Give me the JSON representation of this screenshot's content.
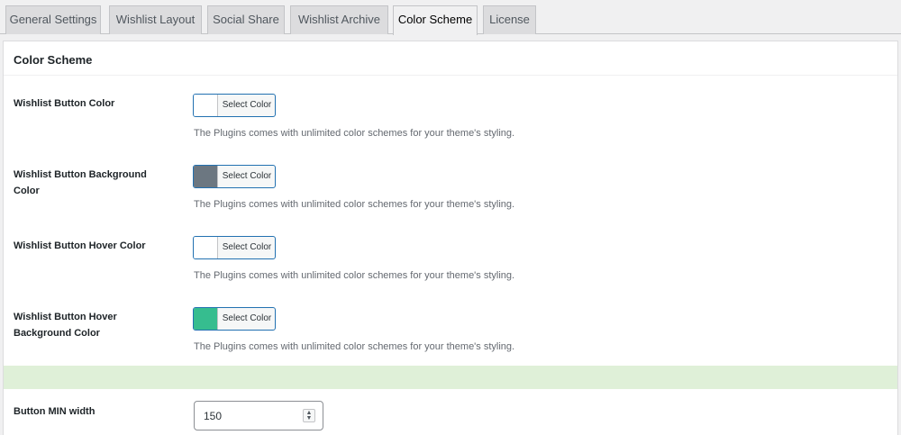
{
  "tabs": [
    {
      "label": "General Settings",
      "active": false
    },
    {
      "label": "Wishlist Layout",
      "active": false
    },
    {
      "label": "Social Share",
      "active": false
    },
    {
      "label": "Wishlist Archive",
      "active": false
    },
    {
      "label": "Color Scheme",
      "active": true
    },
    {
      "label": "License",
      "active": false
    }
  ],
  "section": {
    "title": "Color Scheme"
  },
  "fields": [
    {
      "label": "Wishlist Button Color",
      "button_label": "Select Color",
      "color": "#ffffff",
      "description": "The Plugins comes with unlimited color schemes for your theme's styling."
    },
    {
      "label": "Wishlist Button Background Color",
      "button_label": "Select Color",
      "color": "#6c7781",
      "description": "The Plugins comes with unlimited color schemes for your theme's styling."
    },
    {
      "label": "Wishlist Button Hover Color",
      "button_label": "Select Color",
      "color": "#ffffff",
      "description": "The Plugins comes with unlimited color schemes for your theme's styling."
    },
    {
      "label": "Wishlist Button Hover Background Color",
      "button_label": "Select Color",
      "color": "#36bd8f",
      "description": "The Plugins comes with unlimited color schemes for your theme's styling."
    }
  ],
  "min_width": {
    "label": "Button MIN width",
    "value": "150"
  },
  "spinner_icon": "up-down-arrows-icon"
}
